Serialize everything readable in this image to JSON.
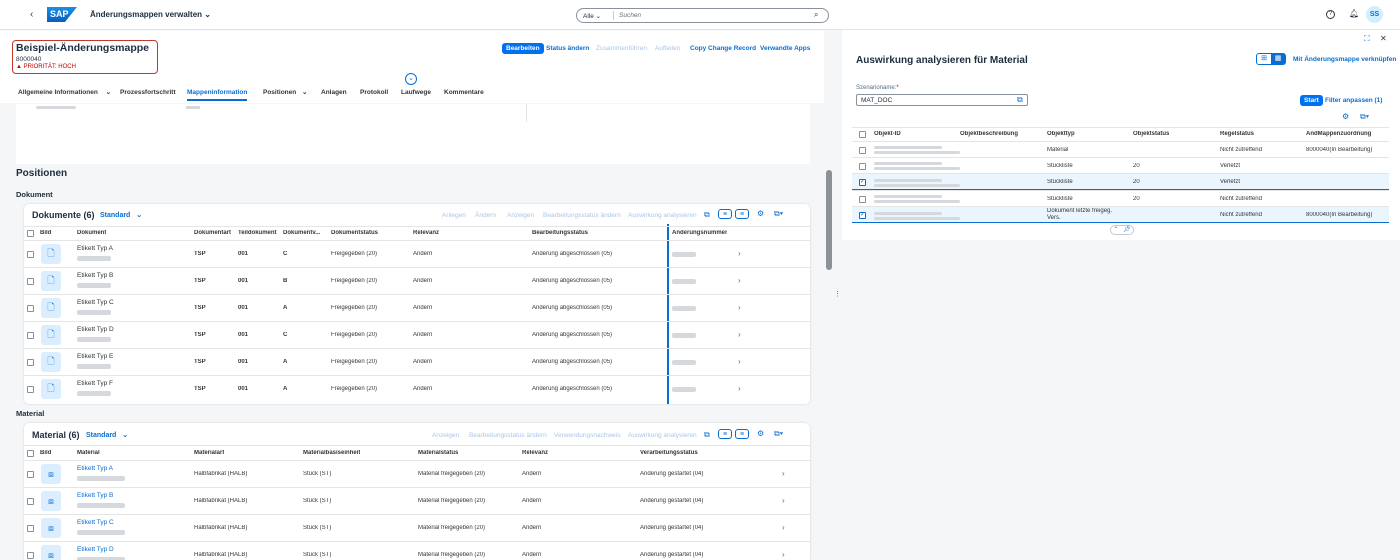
{
  "shell": {
    "back_icon": "chevron-left-icon",
    "logo": "SAP",
    "app_title": "Änderungsmappen verwalten",
    "search_scope": "Alle",
    "search_placeholder": "Suchen",
    "avatar": "SS"
  },
  "header": {
    "title": "Beispiel-Änderungsmappe",
    "id": "8000040",
    "priority": "PRIORITÄT: HOCH",
    "actions": {
      "edit": "Bearbeiten",
      "change_status": "Status ändern",
      "merge": "Zusammenführen",
      "split": "Aufteilen",
      "copy": "Copy Change Record",
      "related": "Verwandte Apps"
    }
  },
  "tabs": [
    "Allgemeine Informationen",
    "Prozessfortschritt",
    "Mappeninformation",
    "Positionen",
    "Anlagen",
    "Protokoll",
    "Laufwege",
    "Kommentare"
  ],
  "positions": {
    "title": "Positionen",
    "document_section": "Dokument",
    "material_section": "Material"
  },
  "doc_table": {
    "title": "Dokumente (6)",
    "variant": "Standard",
    "toolbar": [
      "Anlegen",
      "Ändern",
      "Anzeigen",
      "Bearbeitungsstatus ändern",
      "Auswirkung analysieren"
    ],
    "columns": [
      "Bild",
      "Dokument",
      "Dokumentart",
      "Teildokument",
      "Dokumentv...",
      "Dokumentstatus",
      "Relevanz",
      "Bearbeitungsstatus",
      "Änderungsnummer"
    ],
    "rows": [
      {
        "name": "Etikett Typ A",
        "art": "TSP",
        "teil": "001",
        "version": "C",
        "status": "Freigegeben (20)",
        "relevanz": "Ändern",
        "bstatus": "Änderung abgeschlossen (05)"
      },
      {
        "name": "Etikett Typ B",
        "art": "TSP",
        "teil": "001",
        "version": "B",
        "status": "Freigegeben (20)",
        "relevanz": "Ändern",
        "bstatus": "Änderung abgeschlossen (05)"
      },
      {
        "name": "Etikett Typ C",
        "art": "TSP",
        "teil": "001",
        "version": "A",
        "status": "Freigegeben (20)",
        "relevanz": "Ändern",
        "bstatus": "Änderung abgeschlossen (05)"
      },
      {
        "name": "Etikett Typ D",
        "art": "TSP",
        "teil": "001",
        "version": "C",
        "status": "Freigegeben (20)",
        "relevanz": "Ändern",
        "bstatus": "Änderung abgeschlossen (05)"
      },
      {
        "name": "Etikett Typ E",
        "art": "TSP",
        "teil": "001",
        "version": "A",
        "status": "Freigegeben (20)",
        "relevanz": "Ändern",
        "bstatus": "Änderung abgeschlossen (05)"
      },
      {
        "name": "Etikett Typ F",
        "art": "TSP",
        "teil": "001",
        "version": "A",
        "status": "Freigegeben (20)",
        "relevanz": "Ändern",
        "bstatus": "Änderung abgeschlossen (05)"
      }
    ]
  },
  "mat_table": {
    "title": "Material (6)",
    "variant": "Standard",
    "toolbar": [
      "Anzeigen",
      "Bearbeitungsstatus ändern",
      "Verwendungsnachweis",
      "Auswirkung analysieren"
    ],
    "columns": [
      "Bild",
      "Material",
      "Materialart",
      "Materialbasiseinheit",
      "Materialstatus",
      "Relevanz",
      "Verarbeitungsstatus"
    ],
    "rows": [
      {
        "name": "Etikett Typ A",
        "art": "Halbfabrikat (HALB)",
        "unit": "Stück (ST)",
        "status": "Material freigegeben (20)",
        "relevanz": "Ändern",
        "vstatus": "Änderung gestartet (04)"
      },
      {
        "name": "Etikett Typ B",
        "art": "Halbfabrikat (HALB)",
        "unit": "Stück (ST)",
        "status": "Material freigegeben (20)",
        "relevanz": "Ändern",
        "vstatus": "Änderung gestartet (04)"
      },
      {
        "name": "Etikett Typ C",
        "art": "Halbfabrikat (HALB)",
        "unit": "Stück (ST)",
        "status": "Material freigegeben (20)",
        "relevanz": "Ändern",
        "vstatus": "Änderung gestartet (04)"
      },
      {
        "name": "Etikett Typ D",
        "art": "Halbfabrikat (HALB)",
        "unit": "Stück (ST)",
        "status": "Material freigegeben (20)",
        "relevanz": "Ändern",
        "vstatus": "Änderung gestartet (04)"
      }
    ]
  },
  "panel": {
    "title": "Auswirkung analysieren für Material",
    "link_action": "Mit Änderungsmappe verknüpfen",
    "scenario_label": "Szenarioname:",
    "scenario_required": "*",
    "scenario_value": "MAT_DOC",
    "start": "Start",
    "filter": "Filter anpassen (1)",
    "columns": [
      "Objekt-ID",
      "Objektbeschreibung",
      "Objekttyp",
      "Objektstatus",
      "Regelstatus",
      "ÄndMappenzuordnung"
    ],
    "rows": [
      {
        "typ": "Material",
        "status": "",
        "regel": "Nicht zutreffend",
        "zuordnung": "8000040(In Bearbeitung)",
        "checked": false
      },
      {
        "typ": "Stückliste",
        "status": "20",
        "regel": "Verletzt",
        "zuordnung": "",
        "checked": false
      },
      {
        "typ": "Stückliste",
        "status": "20",
        "regel": "Verletzt",
        "zuordnung": "",
        "checked": true
      },
      {
        "typ": "Stückliste",
        "status": "20",
        "regel": "Nicht zutreffend",
        "zuordnung": "",
        "checked": false
      },
      {
        "typ": "Dokument letzte freigeg. Vers.",
        "status": "",
        "regel": "Nicht zutreffend",
        "zuordnung": "8000040(In Bearbeitung)",
        "checked": true
      }
    ]
  }
}
